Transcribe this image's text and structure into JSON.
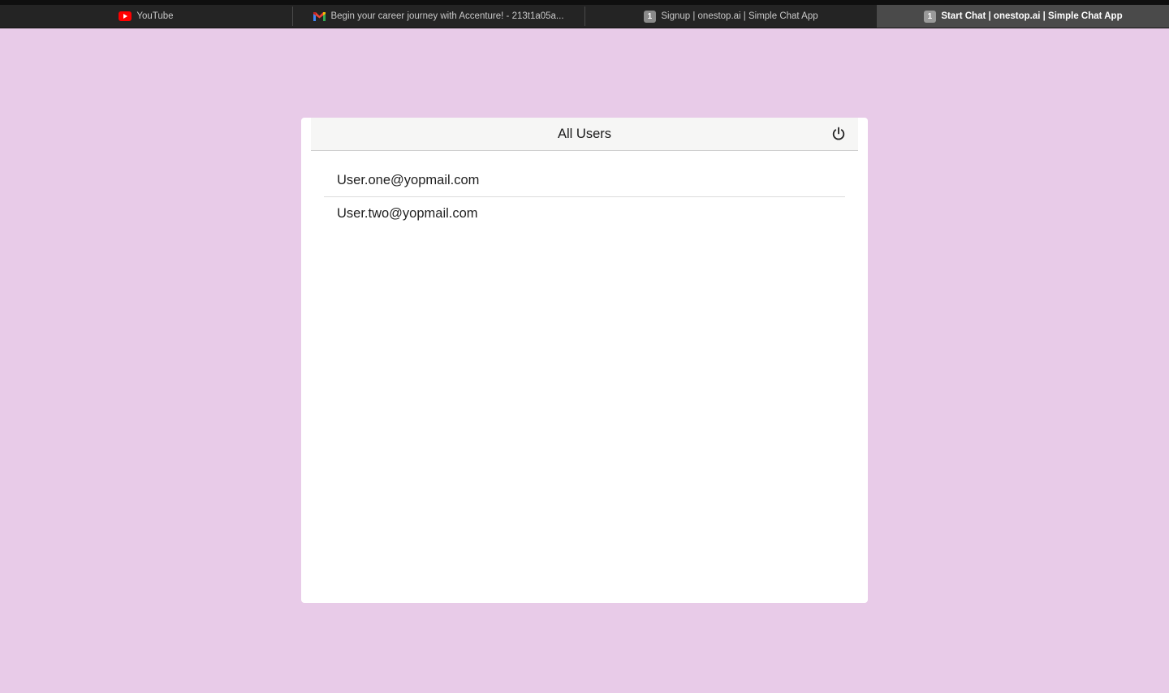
{
  "browser": {
    "tabs": [
      {
        "label": "YouTube",
        "icon": "youtube-icon",
        "active": false
      },
      {
        "label": "Begin your career journey with Accenture! - 213t1a05a...",
        "icon": "gmail-icon",
        "active": false
      },
      {
        "label": "Signup | onestop.ai | Simple Chat App",
        "icon": "numbered-favicon",
        "badge": "1",
        "active": false
      },
      {
        "label": "Start Chat | onestop.ai | Simple Chat App",
        "icon": "numbered-favicon",
        "badge": "1",
        "active": true
      }
    ]
  },
  "panel": {
    "title": "All Users",
    "logout_icon": "power-icon"
  },
  "users": [
    {
      "email": "User.one@yopmail.com"
    },
    {
      "email": "User.two@yopmail.com"
    }
  ],
  "colors": {
    "page_background": "#e8cbe8",
    "card_background": "#ffffff",
    "header_background": "#f6f6f5",
    "tabbar_background": "#242424",
    "active_tab_background": "#4a4a4a"
  }
}
